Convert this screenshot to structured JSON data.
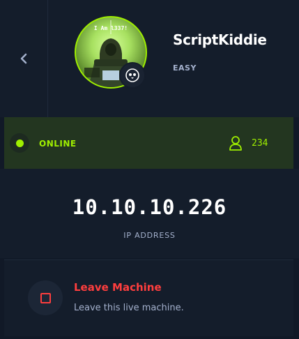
{
  "machine": {
    "name": "ScriptKiddie",
    "difficulty": "EASY",
    "avatar_text": "I Am l337!",
    "os_icon": "linux-penguin-icon"
  },
  "status": {
    "label": "ONLINE",
    "players_count": "234",
    "color": "#9fef00"
  },
  "network": {
    "ip": "10.10.10.226",
    "ip_label": "IP ADDRESS"
  },
  "action": {
    "title": "Leave Machine",
    "description": "Leave this live machine.",
    "color": "#ff3e3e"
  },
  "navigation": {
    "back_icon": "chevron-left-icon"
  }
}
